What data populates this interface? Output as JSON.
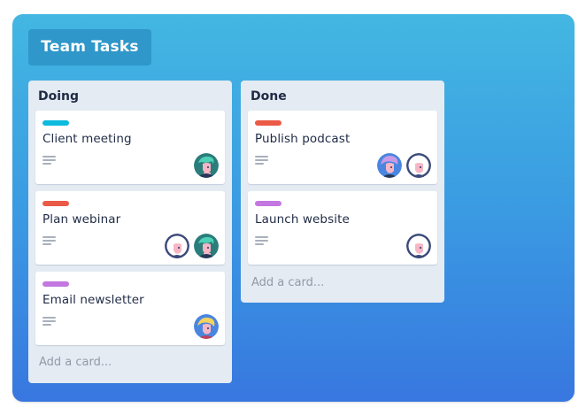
{
  "board": {
    "title": "Team Tasks"
  },
  "colors": {
    "board_top": "#43b7e2",
    "board_bottom": "#3877e0",
    "title_bg": "#2f97c9",
    "list_bg": "#e4ebf3",
    "label_cyan": "#0fbadf",
    "label_red": "#eb5a46",
    "label_purple": "#c377e0"
  },
  "lists": [
    {
      "title": "Doing",
      "add_card": "Add a card...",
      "cards": [
        {
          "title": "Client meeting",
          "label_color": "label_cyan",
          "has_description": true,
          "avatars": [
            "avatar-teal-hair"
          ]
        },
        {
          "title": "Plan webinar",
          "label_color": "label_red",
          "has_description": true,
          "avatars": [
            "avatar-white-hair",
            "avatar-teal-hair"
          ]
        },
        {
          "title": "Email newsletter",
          "label_color": "label_purple",
          "has_description": true,
          "avatars": [
            "avatar-blonde-hair"
          ]
        }
      ]
    },
    {
      "title": "Done",
      "add_card": "Add a card...",
      "cards": [
        {
          "title": "Publish podcast",
          "label_color": "label_red",
          "has_description": true,
          "avatars": [
            "avatar-purple-hair",
            "avatar-white-hair"
          ]
        },
        {
          "title": "Launch website",
          "label_color": "label_purple",
          "has_description": true,
          "avatars": [
            "avatar-white-hair"
          ]
        }
      ]
    }
  ]
}
